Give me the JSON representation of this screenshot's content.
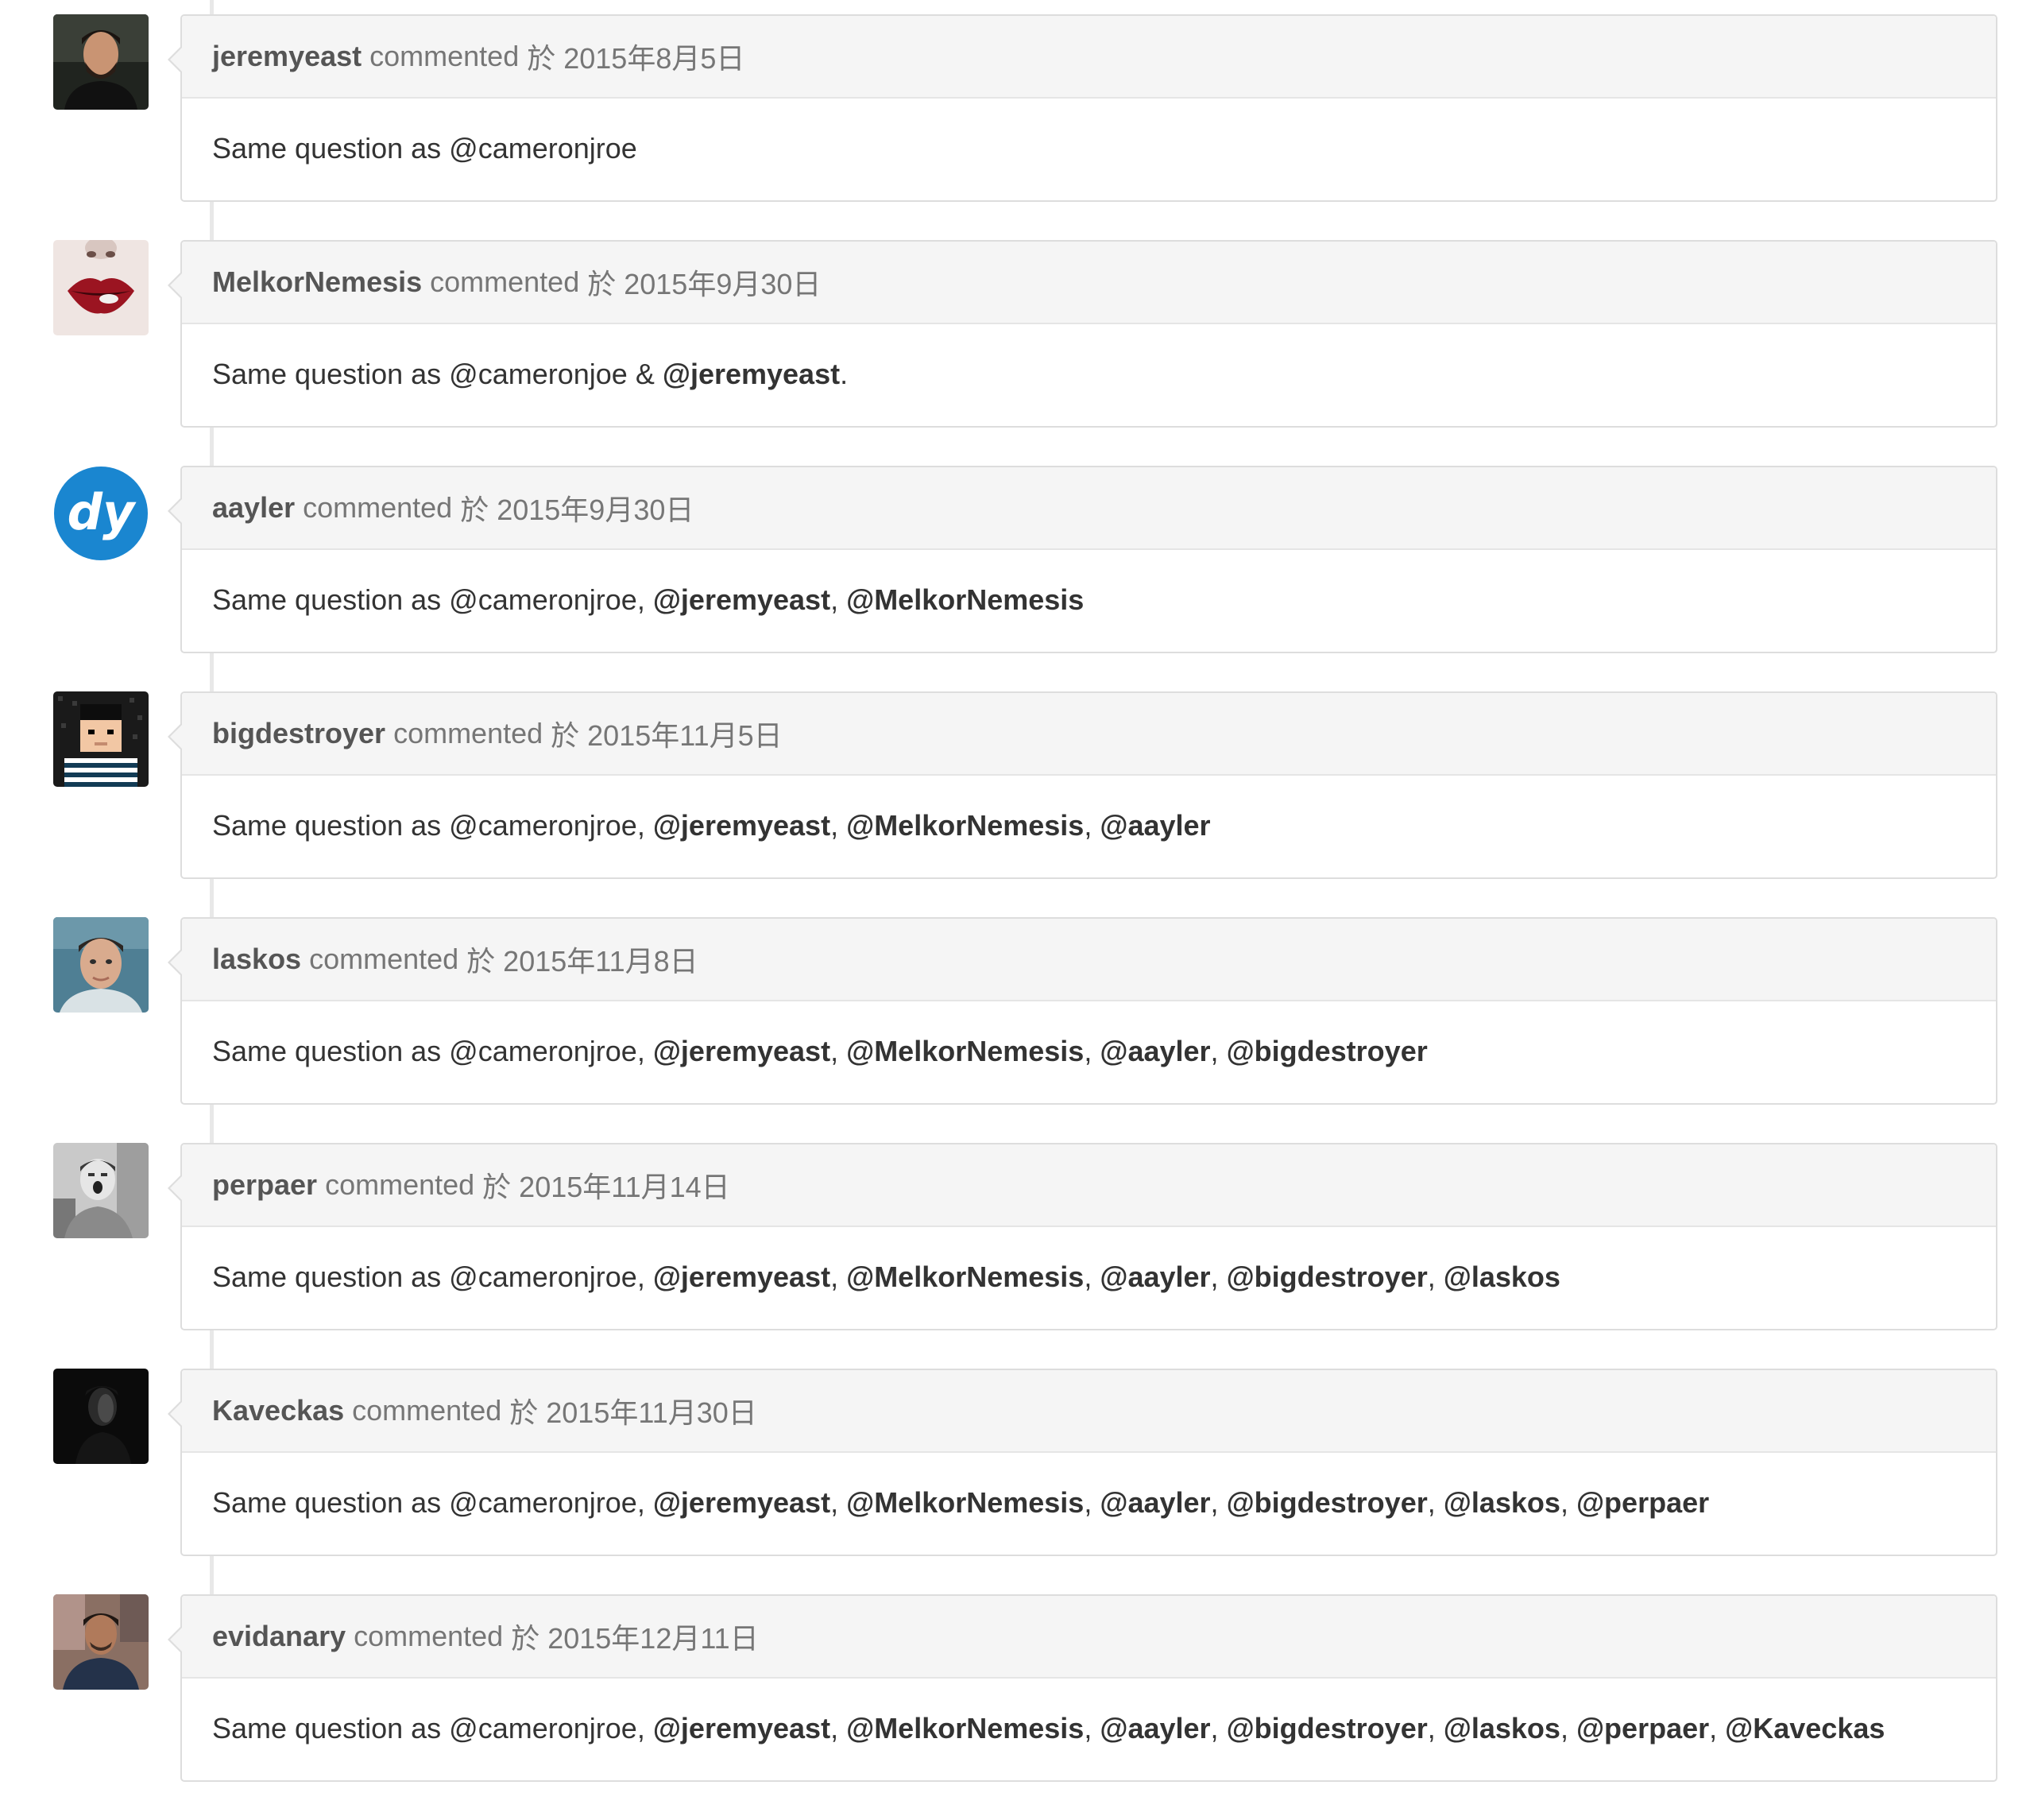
{
  "comments": [
    {
      "author": "jeremyeast",
      "action": "commented",
      "date": "於 2015年8月5日",
      "text": "Same question as @cameronjroe",
      "mentions": []
    },
    {
      "author": "MelkorNemesis",
      "action": "commented",
      "date": "於 2015年9月30日",
      "text": "Same question as @cameronjoe & ",
      "mentions": [
        {
          "handle": "@jeremyeast",
          "sep": "."
        }
      ]
    },
    {
      "author": "aayler",
      "action": "commented",
      "date": "於 2015年9月30日",
      "text": "Same question as @cameronjroe, ",
      "mentions": [
        {
          "handle": "@jeremyeast",
          "sep": ", "
        },
        {
          "handle": "@MelkorNemesis",
          "sep": ""
        }
      ]
    },
    {
      "author": "bigdestroyer",
      "action": "commented",
      "date": "於 2015年11月5日",
      "text": "Same question as @cameronjroe, ",
      "mentions": [
        {
          "handle": "@jeremyeast",
          "sep": ", "
        },
        {
          "handle": "@MelkorNemesis",
          "sep": ", "
        },
        {
          "handle": "@aayler",
          "sep": ""
        }
      ]
    },
    {
      "author": "laskos",
      "action": "commented",
      "date": "於 2015年11月8日",
      "text": "Same question as @cameronjroe, ",
      "mentions": [
        {
          "handle": "@jeremyeast",
          "sep": ", "
        },
        {
          "handle": "@MelkorNemesis",
          "sep": ", "
        },
        {
          "handle": "@aayler",
          "sep": ", "
        },
        {
          "handle": "@bigdestroyer",
          "sep": ""
        }
      ]
    },
    {
      "author": "perpaer",
      "action": "commented",
      "date": "於 2015年11月14日",
      "text": "Same question as @cameronjroe, ",
      "mentions": [
        {
          "handle": "@jeremyeast",
          "sep": ", "
        },
        {
          "handle": "@MelkorNemesis",
          "sep": ", "
        },
        {
          "handle": "@aayler",
          "sep": ", "
        },
        {
          "handle": "@bigdestroyer",
          "sep": ", "
        },
        {
          "handle": "@laskos",
          "sep": ""
        }
      ]
    },
    {
      "author": "Kaveckas",
      "action": "commented",
      "date": "於 2015年11月30日",
      "text": "Same question as @cameronjroe, ",
      "mentions": [
        {
          "handle": "@jeremyeast",
          "sep": ", "
        },
        {
          "handle": "@MelkorNemesis",
          "sep": ", "
        },
        {
          "handle": "@aayler",
          "sep": ", "
        },
        {
          "handle": "@bigdestroyer",
          "sep": ", "
        },
        {
          "handle": "@laskos",
          "sep": ", "
        },
        {
          "handle": "@perpaer",
          "sep": ""
        }
      ]
    },
    {
      "author": "evidanary",
      "action": "commented",
      "date": "於 2015年12月11日",
      "text": "Same question as @cameronjroe, ",
      "mentions": [
        {
          "handle": "@jeremyeast",
          "sep": ", "
        },
        {
          "handle": "@MelkorNemesis",
          "sep": ", "
        },
        {
          "handle": "@aayler",
          "sep": ", "
        },
        {
          "handle": "@bigdestroyer",
          "sep": ", "
        },
        {
          "handle": "@laskos",
          "sep": ", "
        },
        {
          "handle": "@perpaer",
          "sep": ", "
        },
        {
          "handle": "@Kaveckas",
          "sep": ""
        }
      ]
    }
  ],
  "avatar_logo_text": "dy",
  "colors": {
    "header_bg": "#f5f5f5",
    "border": "#dddddd",
    "logo_blue": "#1a86d0"
  }
}
